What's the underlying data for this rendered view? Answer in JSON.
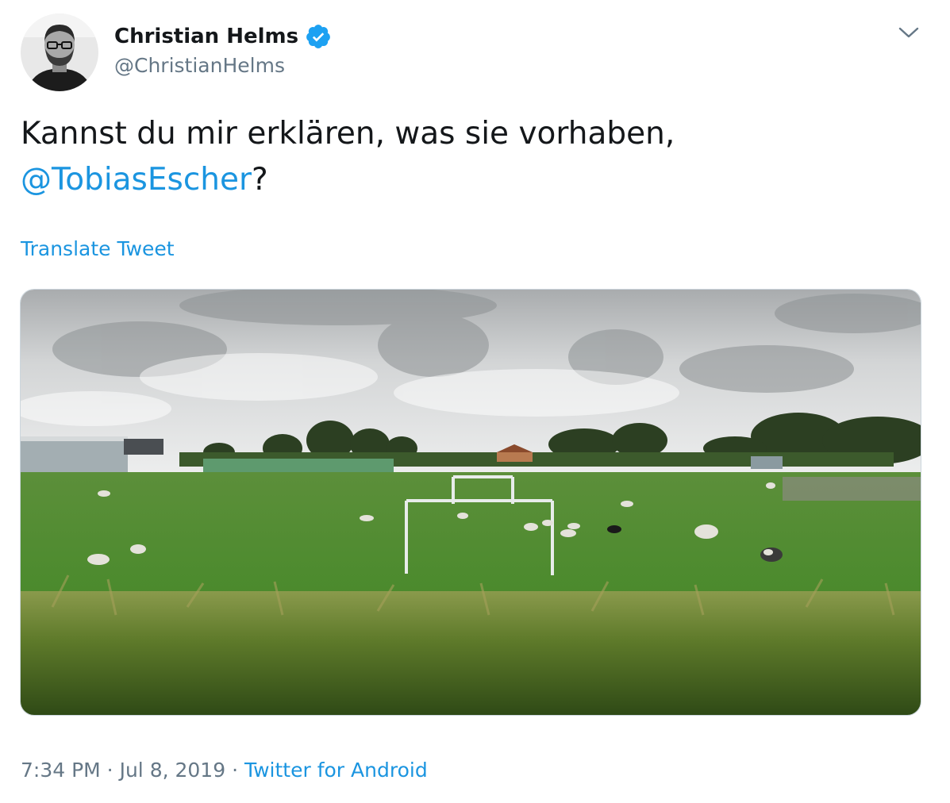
{
  "author": {
    "display_name": "Christian Helms",
    "handle": "@ChristianHelms",
    "verified": true,
    "avatar_icon": "profile-photo"
  },
  "tweet": {
    "text_before": "Kannst du mir erklären, was sie vorhaben,",
    "mention": "@TobiasEscher",
    "text_after": "?",
    "translate_label": "Translate Tweet",
    "media_icon": "photo-field-with-sheep-and-goals"
  },
  "meta": {
    "time": "7:34 PM",
    "separator1": " · ",
    "date": "Jul 8, 2019",
    "separator2": " · ",
    "source": "Twitter for Android"
  },
  "colors": {
    "link": "#1b95e0",
    "secondary_text": "#657786",
    "verified_badge": "#1da1f2"
  },
  "icons": {
    "caret": "chevron-down-icon",
    "verified": "verified-badge-icon"
  }
}
